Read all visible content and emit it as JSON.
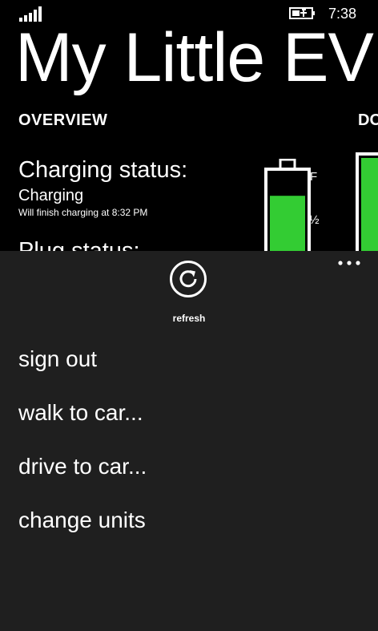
{
  "status_bar": {
    "time": "7:38",
    "signal_icon": "signal-strength-icon",
    "battery_icon": "battery-charging-icon"
  },
  "app": {
    "title": "My Little EV"
  },
  "pivot": {
    "current": "OVERVIEW",
    "next_peek": "DO"
  },
  "overview": {
    "charging_status_label": "Charging status:",
    "charging_status_value": "Charging",
    "finish_text": "Will finish charging at 8:32 PM",
    "plug_status_label": "Plug status:",
    "battery_level": 0.73,
    "battery_full_mark": "F",
    "battery_half_mark": "½",
    "battery_fill_color": "#33cc33"
  },
  "appbar": {
    "refresh_label": "refresh",
    "refresh_icon": "refresh-icon",
    "more_icon": "ellipsis-icon",
    "menu_items": [
      "sign out",
      "walk to car...",
      "drive to car...",
      "change units"
    ],
    "background": "#1f1f1f"
  }
}
